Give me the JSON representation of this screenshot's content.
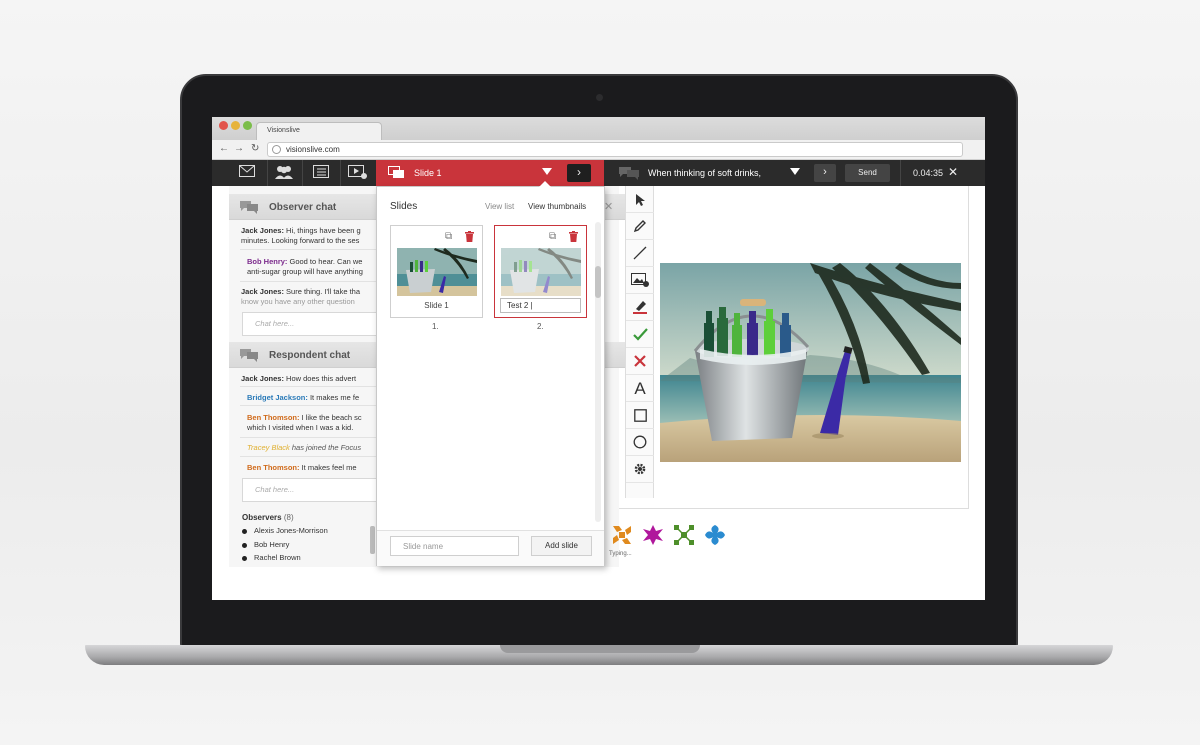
{
  "browser": {
    "tab_title": "Visionslive",
    "url": "visionslive.com",
    "back_icon": "arrow-left-icon",
    "forward_icon": "arrow-right-icon",
    "refresh_icon": "refresh-icon"
  },
  "toolbar": {
    "icons": [
      "mail-icon",
      "people-icon",
      "list-icon",
      "media-icon"
    ],
    "slide_label": "Slide 1",
    "next_glyph": "›",
    "question": "When thinking of soft drinks,",
    "question_next_glyph": "›",
    "send_label": "Send",
    "timer": "0.04:35",
    "close_glyph": "✕",
    "accent_color": "#c9343b"
  },
  "observer_chat": {
    "title": "Observer chat",
    "close_glyph": "✕",
    "messages": [
      {
        "author": "Jack Jones:",
        "text": " Hi, things have been g",
        "text2": "minutes. Looking forward to the ses",
        "color": "#333"
      },
      {
        "author": "Bob Henry:",
        "text": " Good to hear. Can we",
        "text2": "anti-sugar group will have anything",
        "color": "#7b2a8c"
      },
      {
        "author": "Jack Jones:",
        "text": " Sure thing. I'll take tha",
        "text2": "know you have any other question",
        "color": "#333"
      }
    ],
    "input_placeholder": "Chat here..."
  },
  "respondent_chat": {
    "title": "Respondent chat",
    "messages": [
      {
        "author": "Jack Jones:",
        "text": " How does this advert",
        "color": "#333"
      },
      {
        "author": "Bridget Jackson:",
        "text": " It makes me fe",
        "color": "#2a7ab8"
      },
      {
        "author": "Ben Thomson:",
        "text": " I like the beach sc",
        "text2": "which I visited when I was a kid.",
        "color": "#d06a1a"
      },
      {
        "author": "Tracey Black",
        "text": " has joined the Focus",
        "color": "#e0b030",
        "system": true
      },
      {
        "author": "Ben Thomson:",
        "text": " It makes feel me",
        "color": "#d06a1a"
      }
    ],
    "input_placeholder": "Chat here..."
  },
  "observers": {
    "title": "Observers",
    "count": "(8)",
    "names": [
      "Alexis Jones-Morrison",
      "Bob Henry",
      "Rachel Brown"
    ]
  },
  "slides_popup": {
    "title": "Slides",
    "view_list": "View list",
    "view_thumbnails": "View thumbnails",
    "slides": [
      {
        "label": "Slide 1",
        "number": "1."
      },
      {
        "label": "Test 2",
        "number": "2."
      }
    ],
    "slide_name_placeholder": "Slide name",
    "add_slide_label": "Add slide"
  },
  "tools": [
    "cursor-icon",
    "pen-icon",
    "line-icon",
    "image-add-icon",
    "highlighter-icon",
    "check-icon",
    "cross-icon",
    "text-icon",
    "rectangle-icon",
    "circle-icon",
    "settings-icon"
  ],
  "participants": {
    "typing_label": "Typing...",
    "avatar_colors": [
      "#e08a1e",
      "#b0179c",
      "#4e8f2a",
      "#2a8bd0"
    ]
  }
}
